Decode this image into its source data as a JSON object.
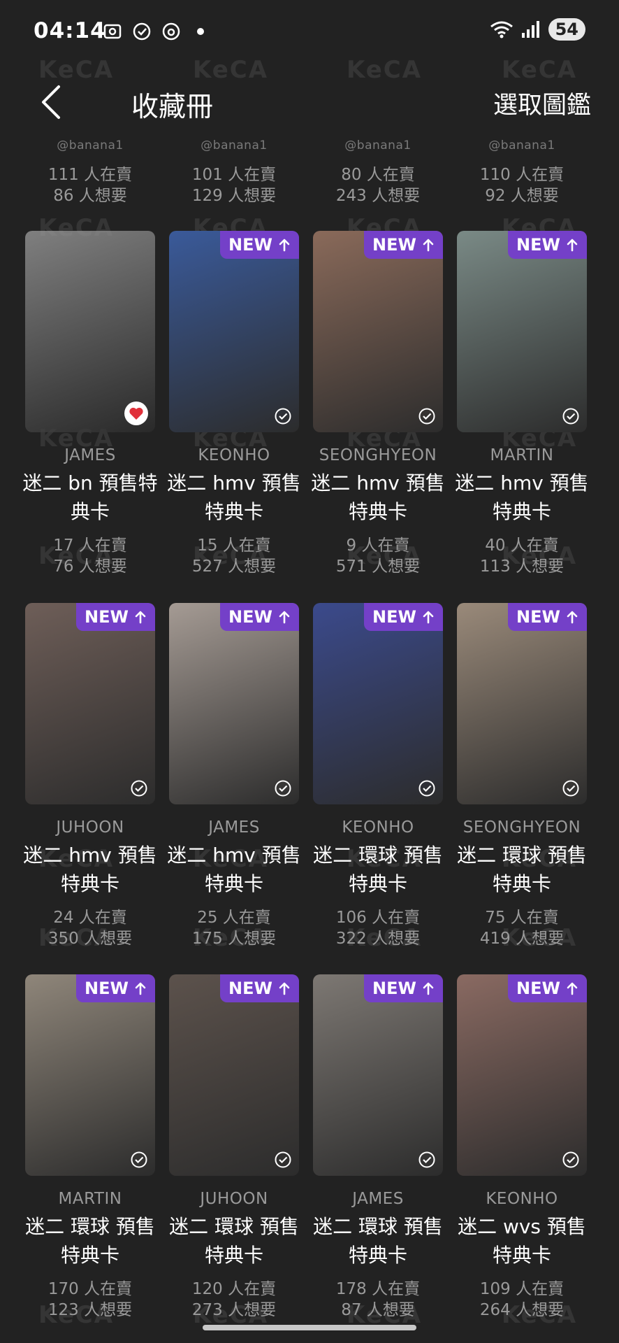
{
  "status": {
    "time": "04:14",
    "battery": "54"
  },
  "header": {
    "title": "收藏冊",
    "select_label": "選取圖鑑",
    "back_icon": "chevron-left-icon"
  },
  "watermark": "KeCA",
  "top_row": [
    {
      "handle": "@banana1",
      "sell": "111 人在賣",
      "want": "86 人想要"
    },
    {
      "handle": "@banana1",
      "sell": "101 人在賣",
      "want": "129 人想要"
    },
    {
      "handle": "@banana1",
      "sell": "80 人在賣",
      "want": "243 人想要"
    },
    {
      "handle": "@banana1",
      "sell": "110 人在賣",
      "want": "92 人想要"
    }
  ],
  "cards": [
    {
      "member": "JAMES",
      "title": "迷二 bn 預售特典卡",
      "sell": "17 人在賣",
      "want": "76 人想要",
      "new": false,
      "liked": true,
      "color": "#9e9e9e"
    },
    {
      "member": "KEONHO",
      "title": "迷二 hmv 預售 特典卡",
      "sell": "15 人在賣",
      "want": "527 人想要",
      "new": true,
      "liked": false,
      "color": "#3a5a9a"
    },
    {
      "member": "SEONGHYEON",
      "title": "迷二 hmv 預售 特典卡",
      "sell": "9 人在賣",
      "want": "571 人想要",
      "new": true,
      "liked": false,
      "color": "#8a6a5a"
    },
    {
      "member": "MARTIN",
      "title": "迷二 hmv 預售 特典卡",
      "sell": "40 人在賣",
      "want": "113 人想要",
      "new": true,
      "liked": false,
      "color": "#7a8a86"
    },
    {
      "member": "JUHOON",
      "title": "迷二 hmv 預售 特典卡",
      "sell": "24 人在賣",
      "want": "350 人想要",
      "new": true,
      "liked": false,
      "color": "#6e5e58"
    },
    {
      "member": "JAMES",
      "title": "迷二 hmv 預售 特典卡",
      "sell": "25 人在賣",
      "want": "175 人想要",
      "new": true,
      "liked": false,
      "color": "#a59b94"
    },
    {
      "member": "KEONHO",
      "title": "迷二 環球 預售 特典卡",
      "sell": "106 人在賣",
      "want": "322 人想要",
      "new": true,
      "liked": false,
      "color": "#3b4a8c"
    },
    {
      "member": "SEONGHYEON",
      "title": "迷二 環球 預售 特典卡",
      "sell": "75 人在賣",
      "want": "419 人想要",
      "new": true,
      "liked": false,
      "color": "#9a8a7a"
    },
    {
      "member": "MARTIN",
      "title": "迷二 環球 預售 特典卡",
      "sell": "170 人在賣",
      "want": "123 人想要",
      "new": true,
      "liked": false,
      "color": "#8f867a"
    },
    {
      "member": "JUHOON",
      "title": "迷二 環球 預售 特典卡",
      "sell": "120 人在賣",
      "want": "273 人想要",
      "new": true,
      "liked": false,
      "color": "#5c524c"
    },
    {
      "member": "JAMES",
      "title": "迷二 環球 預售 特典卡",
      "sell": "178 人在賣",
      "want": "87 人想要",
      "new": true,
      "liked": false,
      "color": "#7d7873"
    },
    {
      "member": "KEONHO",
      "title": "迷二 wvs 預售 特典卡",
      "sell": "109 人在賣",
      "want": "264 人想要",
      "new": true,
      "liked": false,
      "color": "#8a6a62"
    }
  ],
  "badge_label": "NEW",
  "icons": {
    "new_arrow": "arrow-up-icon",
    "check": "check-circle-icon",
    "heart": "heart-icon"
  },
  "colors": {
    "background": "#222222",
    "badge": "#7440c8",
    "heart": "#e0303a"
  }
}
